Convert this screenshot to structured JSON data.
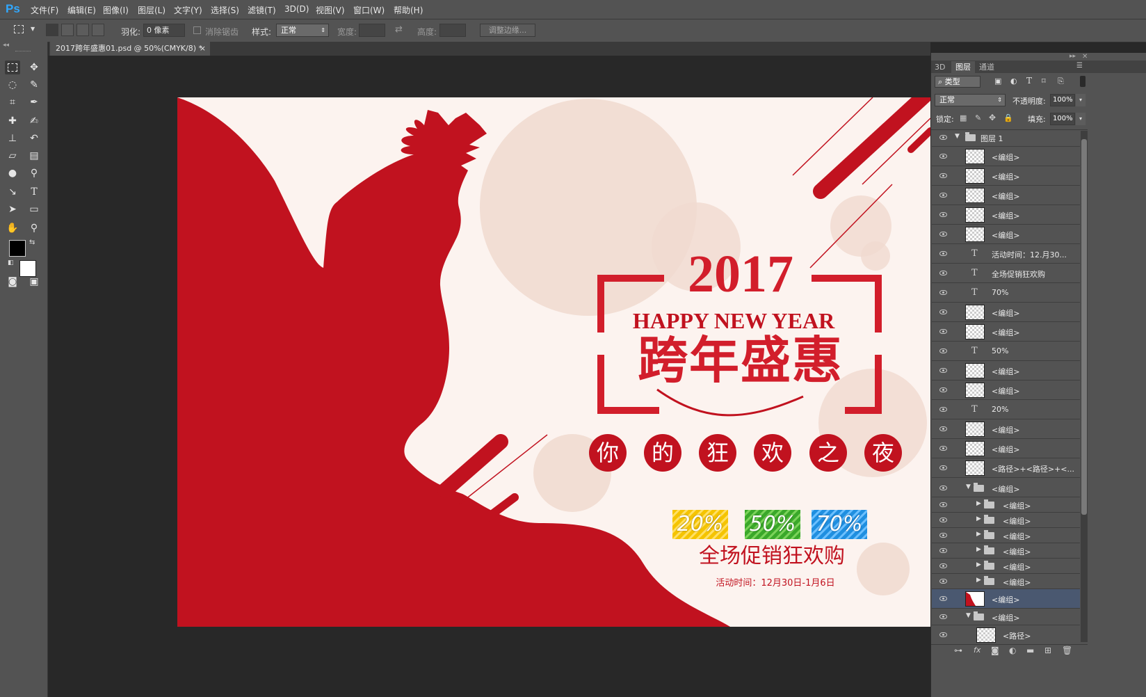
{
  "app": {
    "logo": "Ps"
  },
  "menu": [
    "文件(F)",
    "编辑(E)",
    "图像(I)",
    "图层(L)",
    "文字(Y)",
    "选择(S)",
    "滤镜(T)",
    "3D(D)",
    "视图(V)",
    "窗口(W)",
    "帮助(H)"
  ],
  "options": {
    "feather_label": "羽化:",
    "feather_value": "0 像素",
    "antialias_label": "消除锯齿",
    "style_label": "样式:",
    "style_value": "正常",
    "width_label": "宽度:",
    "height_label": "高度:",
    "refine_button": "调整边缘..."
  },
  "document": {
    "tab_title": "2017跨年盛惠01.psd @ 50%(CMYK/8) *",
    "close": "×"
  },
  "poster": {
    "year": "2017",
    "subtitle": "HAPPY NEW YEAR",
    "title": "跨年盛惠",
    "circles": [
      "你",
      "的",
      "狂",
      "欢",
      "之",
      "夜"
    ],
    "badges": [
      "20%",
      "50%",
      "70%"
    ],
    "promo": "全场促销狂欢购",
    "date": "活动时间：12月30日-1月6日",
    "colors": {
      "red": "#c1121f",
      "bg": "#fcf3ef",
      "circle": "#f0d9cf",
      "yellow": "#f5c400",
      "green": "#3aa82a",
      "blue": "#1f8fe0"
    }
  },
  "panel": {
    "tabs": [
      "3D",
      "图层",
      "通道"
    ],
    "filter_kind": "类型",
    "blend_mode": "正常",
    "opacity_label": "不透明度:",
    "opacity_value": "100%",
    "lock_label": "锁定:",
    "fill_label": "填充:",
    "fill_value": "100%",
    "layers": [
      {
        "name": "图层 1",
        "type": "group"
      },
      {
        "name": "<编组>",
        "type": "thumb"
      },
      {
        "name": "<编组>",
        "type": "thumb"
      },
      {
        "name": "<编组>",
        "type": "thumb"
      },
      {
        "name": "<编组>",
        "type": "thumb"
      },
      {
        "name": "<编组>",
        "type": "thumb"
      },
      {
        "name": "活动时间：12.月30...",
        "type": "text"
      },
      {
        "name": "全场促销狂欢购",
        "type": "text"
      },
      {
        "name": "70%",
        "type": "text"
      },
      {
        "name": "<编组>",
        "type": "thumb"
      },
      {
        "name": "<编组>",
        "type": "thumb"
      },
      {
        "name": "50%",
        "type": "text"
      },
      {
        "name": "<编组>",
        "type": "thumb"
      },
      {
        "name": "<编组>",
        "type": "thumb"
      },
      {
        "name": "20%",
        "type": "text"
      },
      {
        "name": "<编组>",
        "type": "thumb"
      },
      {
        "name": "<编组>",
        "type": "thumb"
      },
      {
        "name": "<路径>+<路径>+<...",
        "type": "thumb"
      },
      {
        "name": "<编组>",
        "type": "group"
      },
      {
        "name": "<编组>",
        "type": "subgroup"
      },
      {
        "name": "<编组>",
        "type": "subgroup"
      },
      {
        "name": "<编组>",
        "type": "subgroup"
      },
      {
        "name": "<编组>",
        "type": "subgroup"
      },
      {
        "name": "<编组>",
        "type": "subgroup"
      },
      {
        "name": "<编组>",
        "type": "subgroup"
      },
      {
        "name": "<编组>",
        "type": "selected"
      },
      {
        "name": "<编组>",
        "type": "group"
      },
      {
        "name": "<路径>",
        "type": "thumb2"
      }
    ]
  }
}
